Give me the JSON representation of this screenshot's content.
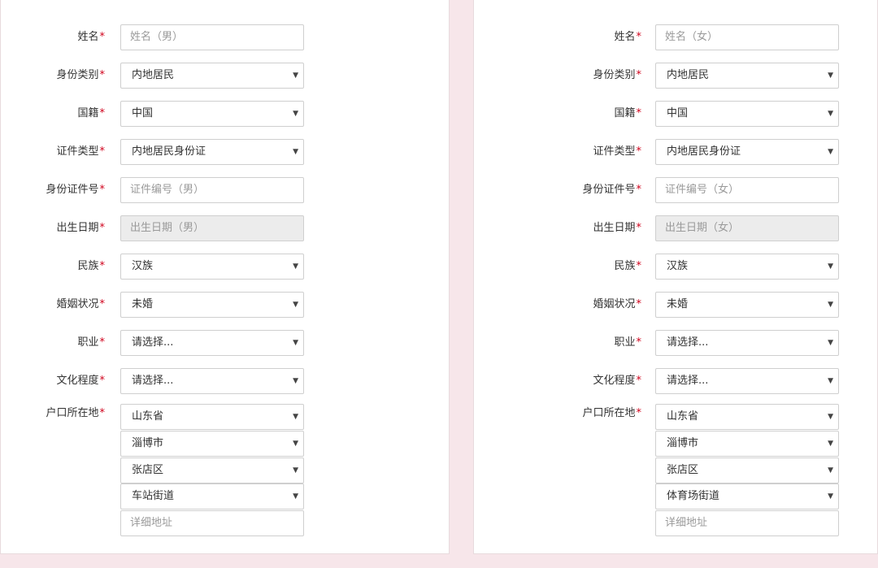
{
  "required_mark": "*",
  "left": {
    "name": {
      "label": "姓名",
      "placeholder": "姓名（男）"
    },
    "id_type_category": {
      "label": "身份类别",
      "value": "内地居民"
    },
    "nationality": {
      "label": "国籍",
      "value": "中国"
    },
    "doc_type": {
      "label": "证件类型",
      "value": "内地居民身份证"
    },
    "id_number": {
      "label": "身份证件号",
      "placeholder": "证件编号（男）"
    },
    "birth_date": {
      "label": "出生日期",
      "placeholder": "出生日期（男）"
    },
    "ethnicity": {
      "label": "民族",
      "value": "汉族"
    },
    "marital": {
      "label": "婚姻状况",
      "value": "未婚"
    },
    "occupation": {
      "label": "职业",
      "value": "请选择..."
    },
    "education": {
      "label": "文化程度",
      "value": "请选择..."
    },
    "residence": {
      "label": "户口所在地",
      "province": "山东省",
      "city": "淄博市",
      "district": "张店区",
      "street": "车站街道",
      "detail_placeholder": "详细地址"
    }
  },
  "right": {
    "name": {
      "label": "姓名",
      "placeholder": "姓名（女）"
    },
    "id_type_category": {
      "label": "身份类别",
      "value": "内地居民"
    },
    "nationality": {
      "label": "国籍",
      "value": "中国"
    },
    "doc_type": {
      "label": "证件类型",
      "value": "内地居民身份证"
    },
    "id_number": {
      "label": "身份证件号",
      "placeholder": "证件编号（女）"
    },
    "birth_date": {
      "label": "出生日期",
      "placeholder": "出生日期（女）"
    },
    "ethnicity": {
      "label": "民族",
      "value": "汉族"
    },
    "marital": {
      "label": "婚姻状况",
      "value": "未婚"
    },
    "occupation": {
      "label": "职业",
      "value": "请选择..."
    },
    "education": {
      "label": "文化程度",
      "value": "请选择..."
    },
    "residence": {
      "label": "户口所在地",
      "province": "山东省",
      "city": "淄博市",
      "district": "张店区",
      "street": "体育场街道",
      "detail_placeholder": "详细地址"
    }
  }
}
